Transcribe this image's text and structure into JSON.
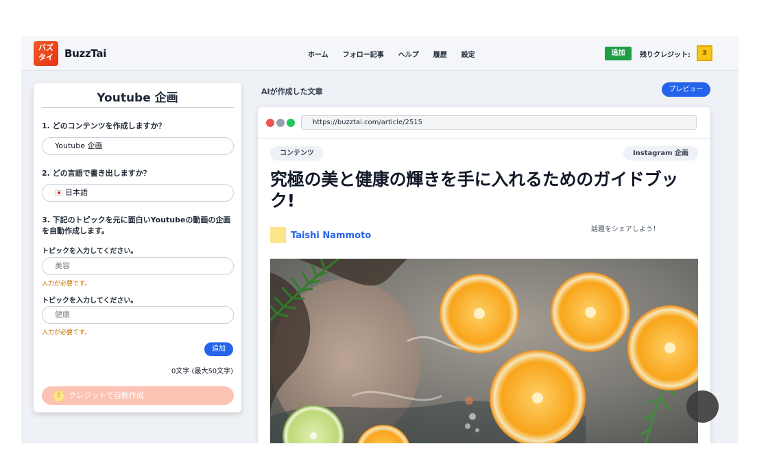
{
  "header": {
    "logo_line1": "バズ",
    "logo_line2": "タイ",
    "app_name": "BuzzTai",
    "nav": [
      "ホーム",
      "フォロー記事",
      "ヘルプ",
      "履歴",
      "設定"
    ],
    "add_label": "追加",
    "credits_label": "残りクレジット:",
    "credits_value": "3"
  },
  "form": {
    "title": "Youtube 企画",
    "q1": "1. どのコンテンツを作成しますか？",
    "q1_value": "Youtube 企画",
    "q2": "2. どの言語で書き出しますか？",
    "q2_value": "日本語",
    "q3": "3. 下記のトピックを元に面白いYoutubeの動画の企画を自動作成します。",
    "topic_label_1": "トピックを入力してください。",
    "topic_value_1": "美容",
    "error_1": "入力が必要です。",
    "topic_label_2": "トピックを入力してください。",
    "topic_value_2": "健康",
    "error_2": "入力が必要です。",
    "add_label": "追加",
    "char_count": "0文字 (最大50文字)",
    "auto_cost": "2",
    "auto_label": "クレジットで自動作成"
  },
  "preview": {
    "section_label": "AIが作成した文章",
    "preview_button": "プレビュー",
    "url": "https://buzztai.com/article/2515",
    "tag_left": "コンテンツ",
    "tag_right": "Instagram 企画",
    "title": "究極の美と健康の輝きを手に入れるためのガイドブック!",
    "author": "Taishi Nammoto",
    "share_text": "話題をシェアしよう！"
  },
  "colors": {
    "brand_orange": "#e8400f",
    "primary_blue": "#2563eb",
    "success_green": "#1f9d45",
    "credit_yellow": "#f5c518",
    "error_orange": "#c27400",
    "auto_button_disabled": "#fcc3b4"
  },
  "icons": {
    "browser_dots": [
      "red",
      "gray",
      "green"
    ],
    "flag": "japan-flag-icon",
    "coin": "credit-coin-icon",
    "fab": "floating-action-icon"
  }
}
